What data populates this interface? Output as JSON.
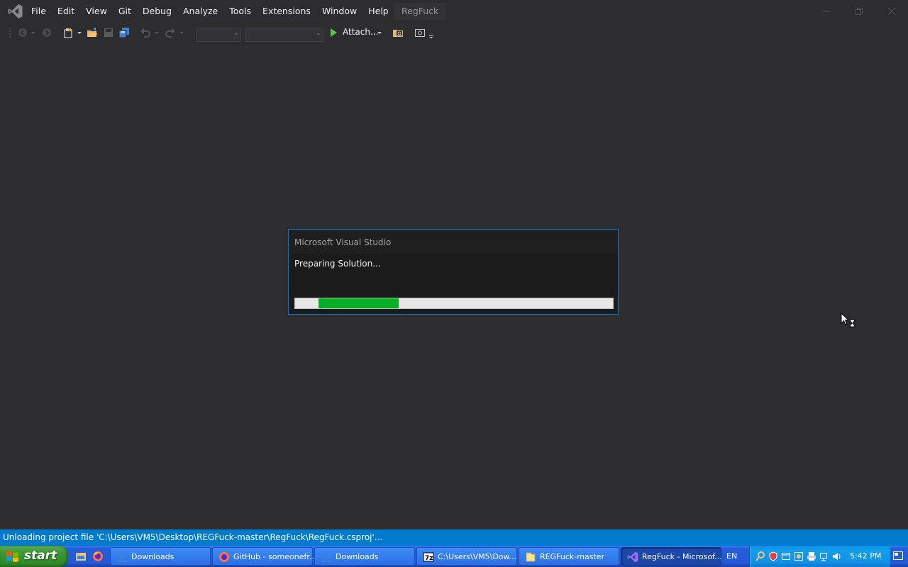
{
  "titlebar": {
    "menu": [
      "File",
      "Edit",
      "View",
      "Git",
      "Debug",
      "Analyze",
      "Tools",
      "Extensions",
      "Window",
      "Help"
    ],
    "solution_name": "RegFuck"
  },
  "toolbar": {
    "attach_label": "Attach..."
  },
  "dialog": {
    "title": "Microsoft Visual Studio",
    "message": "Preparing Solution..."
  },
  "statusbar": {
    "text": "Unloading project file 'C:\\Users\\VM5\\Desktop\\REGFuck-master\\RegFuck\\RegFuck.csproj'..."
  },
  "taskbar": {
    "start_label": "start",
    "tasks": [
      {
        "label": "Downloads",
        "icon": "download-folder-icon"
      },
      {
        "label": "GitHub - someonefr...",
        "icon": "firefox-icon"
      },
      {
        "label": "Downloads",
        "icon": "download-folder-icon"
      },
      {
        "label": "C:\\Users\\VM5\\Dow...",
        "icon": "7zip-icon"
      },
      {
        "label": "REGFuck-master",
        "icon": "folder-icon"
      },
      {
        "label": "RegFuck - Microsof...",
        "icon": "visual-studio-icon"
      }
    ],
    "language": "EN",
    "clock": "5:42 PM"
  },
  "colors": {
    "accent": "#007acc",
    "progress": "#06b025",
    "ide_background": "#2d2d30"
  }
}
